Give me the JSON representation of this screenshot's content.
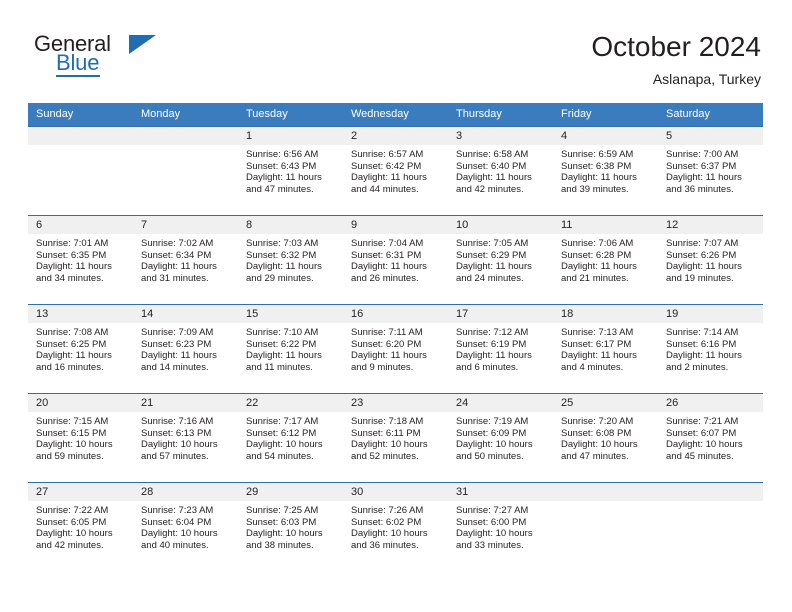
{
  "brand": {
    "line1": "General",
    "line2": "Blue",
    "accent_color": "#1f6db5",
    "text_color": "#231f20"
  },
  "header": {
    "title": "October 2024",
    "subtitle": "Aslanapa, Turkey"
  },
  "calendar": {
    "header_bg": "#3b7cbe",
    "daynum_bg": "#f0f0f0",
    "row_border": "#2f6eb0",
    "weekday_labels": [
      "Sunday",
      "Monday",
      "Tuesday",
      "Wednesday",
      "Thursday",
      "Friday",
      "Saturday"
    ],
    "weeks": [
      [
        {
          "day": "",
          "sunrise": "",
          "sunset": "",
          "daylight_line1": "",
          "daylight_line2": "",
          "empty": true
        },
        {
          "day": "",
          "sunrise": "",
          "sunset": "",
          "daylight_line1": "",
          "daylight_line2": "",
          "empty": true
        },
        {
          "day": "1",
          "sunrise": "Sunrise: 6:56 AM",
          "sunset": "Sunset: 6:43 PM",
          "daylight_line1": "Daylight: 11 hours",
          "daylight_line2": "and 47 minutes.",
          "empty": false
        },
        {
          "day": "2",
          "sunrise": "Sunrise: 6:57 AM",
          "sunset": "Sunset: 6:42 PM",
          "daylight_line1": "Daylight: 11 hours",
          "daylight_line2": "and 44 minutes.",
          "empty": false
        },
        {
          "day": "3",
          "sunrise": "Sunrise: 6:58 AM",
          "sunset": "Sunset: 6:40 PM",
          "daylight_line1": "Daylight: 11 hours",
          "daylight_line2": "and 42 minutes.",
          "empty": false
        },
        {
          "day": "4",
          "sunrise": "Sunrise: 6:59 AM",
          "sunset": "Sunset: 6:38 PM",
          "daylight_line1": "Daylight: 11 hours",
          "daylight_line2": "and 39 minutes.",
          "empty": false
        },
        {
          "day": "5",
          "sunrise": "Sunrise: 7:00 AM",
          "sunset": "Sunset: 6:37 PM",
          "daylight_line1": "Daylight: 11 hours",
          "daylight_line2": "and 36 minutes.",
          "empty": false
        }
      ],
      [
        {
          "day": "6",
          "sunrise": "Sunrise: 7:01 AM",
          "sunset": "Sunset: 6:35 PM",
          "daylight_line1": "Daylight: 11 hours",
          "daylight_line2": "and 34 minutes.",
          "empty": false
        },
        {
          "day": "7",
          "sunrise": "Sunrise: 7:02 AM",
          "sunset": "Sunset: 6:34 PM",
          "daylight_line1": "Daylight: 11 hours",
          "daylight_line2": "and 31 minutes.",
          "empty": false
        },
        {
          "day": "8",
          "sunrise": "Sunrise: 7:03 AM",
          "sunset": "Sunset: 6:32 PM",
          "daylight_line1": "Daylight: 11 hours",
          "daylight_line2": "and 29 minutes.",
          "empty": false
        },
        {
          "day": "9",
          "sunrise": "Sunrise: 7:04 AM",
          "sunset": "Sunset: 6:31 PM",
          "daylight_line1": "Daylight: 11 hours",
          "daylight_line2": "and 26 minutes.",
          "empty": false
        },
        {
          "day": "10",
          "sunrise": "Sunrise: 7:05 AM",
          "sunset": "Sunset: 6:29 PM",
          "daylight_line1": "Daylight: 11 hours",
          "daylight_line2": "and 24 minutes.",
          "empty": false
        },
        {
          "day": "11",
          "sunrise": "Sunrise: 7:06 AM",
          "sunset": "Sunset: 6:28 PM",
          "daylight_line1": "Daylight: 11 hours",
          "daylight_line2": "and 21 minutes.",
          "empty": false
        },
        {
          "day": "12",
          "sunrise": "Sunrise: 7:07 AM",
          "sunset": "Sunset: 6:26 PM",
          "daylight_line1": "Daylight: 11 hours",
          "daylight_line2": "and 19 minutes.",
          "empty": false
        }
      ],
      [
        {
          "day": "13",
          "sunrise": "Sunrise: 7:08 AM",
          "sunset": "Sunset: 6:25 PM",
          "daylight_line1": "Daylight: 11 hours",
          "daylight_line2": "and 16 minutes.",
          "empty": false
        },
        {
          "day": "14",
          "sunrise": "Sunrise: 7:09 AM",
          "sunset": "Sunset: 6:23 PM",
          "daylight_line1": "Daylight: 11 hours",
          "daylight_line2": "and 14 minutes.",
          "empty": false
        },
        {
          "day": "15",
          "sunrise": "Sunrise: 7:10 AM",
          "sunset": "Sunset: 6:22 PM",
          "daylight_line1": "Daylight: 11 hours",
          "daylight_line2": "and 11 minutes.",
          "empty": false
        },
        {
          "day": "16",
          "sunrise": "Sunrise: 7:11 AM",
          "sunset": "Sunset: 6:20 PM",
          "daylight_line1": "Daylight: 11 hours",
          "daylight_line2": "and 9 minutes.",
          "empty": false
        },
        {
          "day": "17",
          "sunrise": "Sunrise: 7:12 AM",
          "sunset": "Sunset: 6:19 PM",
          "daylight_line1": "Daylight: 11 hours",
          "daylight_line2": "and 6 minutes.",
          "empty": false
        },
        {
          "day": "18",
          "sunrise": "Sunrise: 7:13 AM",
          "sunset": "Sunset: 6:17 PM",
          "daylight_line1": "Daylight: 11 hours",
          "daylight_line2": "and 4 minutes.",
          "empty": false
        },
        {
          "day": "19",
          "sunrise": "Sunrise: 7:14 AM",
          "sunset": "Sunset: 6:16 PM",
          "daylight_line1": "Daylight: 11 hours",
          "daylight_line2": "and 2 minutes.",
          "empty": false
        }
      ],
      [
        {
          "day": "20",
          "sunrise": "Sunrise: 7:15 AM",
          "sunset": "Sunset: 6:15 PM",
          "daylight_line1": "Daylight: 10 hours",
          "daylight_line2": "and 59 minutes.",
          "empty": false
        },
        {
          "day": "21",
          "sunrise": "Sunrise: 7:16 AM",
          "sunset": "Sunset: 6:13 PM",
          "daylight_line1": "Daylight: 10 hours",
          "daylight_line2": "and 57 minutes.",
          "empty": false
        },
        {
          "day": "22",
          "sunrise": "Sunrise: 7:17 AM",
          "sunset": "Sunset: 6:12 PM",
          "daylight_line1": "Daylight: 10 hours",
          "daylight_line2": "and 54 minutes.",
          "empty": false
        },
        {
          "day": "23",
          "sunrise": "Sunrise: 7:18 AM",
          "sunset": "Sunset: 6:11 PM",
          "daylight_line1": "Daylight: 10 hours",
          "daylight_line2": "and 52 minutes.",
          "empty": false
        },
        {
          "day": "24",
          "sunrise": "Sunrise: 7:19 AM",
          "sunset": "Sunset: 6:09 PM",
          "daylight_line1": "Daylight: 10 hours",
          "daylight_line2": "and 50 minutes.",
          "empty": false
        },
        {
          "day": "25",
          "sunrise": "Sunrise: 7:20 AM",
          "sunset": "Sunset: 6:08 PM",
          "daylight_line1": "Daylight: 10 hours",
          "daylight_line2": "and 47 minutes.",
          "empty": false
        },
        {
          "day": "26",
          "sunrise": "Sunrise: 7:21 AM",
          "sunset": "Sunset: 6:07 PM",
          "daylight_line1": "Daylight: 10 hours",
          "daylight_line2": "and 45 minutes.",
          "empty": false
        }
      ],
      [
        {
          "day": "27",
          "sunrise": "Sunrise: 7:22 AM",
          "sunset": "Sunset: 6:05 PM",
          "daylight_line1": "Daylight: 10 hours",
          "daylight_line2": "and 42 minutes.",
          "empty": false
        },
        {
          "day": "28",
          "sunrise": "Sunrise: 7:23 AM",
          "sunset": "Sunset: 6:04 PM",
          "daylight_line1": "Daylight: 10 hours",
          "daylight_line2": "and 40 minutes.",
          "empty": false
        },
        {
          "day": "29",
          "sunrise": "Sunrise: 7:25 AM",
          "sunset": "Sunset: 6:03 PM",
          "daylight_line1": "Daylight: 10 hours",
          "daylight_line2": "and 38 minutes.",
          "empty": false
        },
        {
          "day": "30",
          "sunrise": "Sunrise: 7:26 AM",
          "sunset": "Sunset: 6:02 PM",
          "daylight_line1": "Daylight: 10 hours",
          "daylight_line2": "and 36 minutes.",
          "empty": false
        },
        {
          "day": "31",
          "sunrise": "Sunrise: 7:27 AM",
          "sunset": "Sunset: 6:00 PM",
          "daylight_line1": "Daylight: 10 hours",
          "daylight_line2": "and 33 minutes.",
          "empty": false
        },
        {
          "day": "",
          "sunrise": "",
          "sunset": "",
          "daylight_line1": "",
          "daylight_line2": "",
          "empty": true
        },
        {
          "day": "",
          "sunrise": "",
          "sunset": "",
          "daylight_line1": "",
          "daylight_line2": "",
          "empty": true
        }
      ]
    ]
  }
}
